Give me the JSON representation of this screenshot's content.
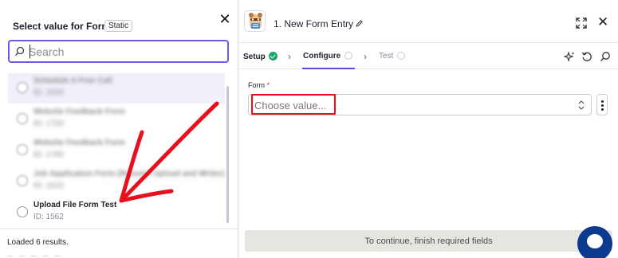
{
  "left_panel": {
    "title": "Select value for Form",
    "badge": "Static",
    "search": {
      "placeholder": "Search",
      "value": ""
    },
    "items": [
      {
        "name": "Schedule A Free Call",
        "id": "ID: 2033"
      },
      {
        "name": "Website Feedback Form",
        "id": "ID: 1720"
      },
      {
        "name": "Website Feedback Form",
        "id": "ID: 1700"
      },
      {
        "name": "Job Application Form (Resume Upload and Writer)",
        "id": "ID: 1510"
      },
      {
        "name": "Upload File Form Test",
        "id": "ID: 1562"
      }
    ],
    "loaded_text": "Loaded 6 results."
  },
  "right_panel": {
    "step_title": "1. New Form Entry",
    "tabs": [
      {
        "label": "Setup",
        "status": "complete"
      },
      {
        "label": "Configure",
        "status": "active"
      },
      {
        "label": "Test",
        "status": "disabled"
      }
    ],
    "form_field": {
      "label": "Form",
      "required_mark": "*",
      "placeholder": "Choose value..."
    },
    "continue_text": "To continue, finish required fields"
  },
  "colors": {
    "accent": "#5d4be3",
    "search_border": "#6b5ce7",
    "success": "#1aa56b",
    "annotation_red": "#e8101c",
    "chat": "#0b3a8f"
  },
  "icons": {
    "close": "close-icon",
    "search": "search-icon",
    "edit": "pencil-icon",
    "expand": "expand-icon",
    "ai": "sparkle-icon",
    "refresh": "refresh-icon",
    "search_tool": "search-icon",
    "select": "chevron-updown-icon",
    "more": "more-vertical-icon",
    "chat": "chat-icon"
  }
}
